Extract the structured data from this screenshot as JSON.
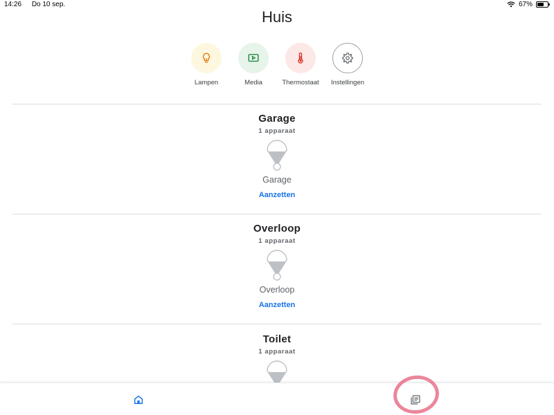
{
  "status": {
    "time": "14:26",
    "date": "Do 10 sep.",
    "battery": "67%",
    "battery_level": 0.67
  },
  "title": "Huis",
  "shortcuts": [
    {
      "label": "Lampen",
      "icon": "lightbulb-icon",
      "color": "#e37400",
      "bg": "#fef7e0"
    },
    {
      "label": "Media",
      "icon": "media-play-icon",
      "color": "#188038",
      "bg": "#e6f4ea"
    },
    {
      "label": "Thermostaat",
      "icon": "thermometer-icon",
      "color": "#d93025",
      "bg": "#fce8e6"
    },
    {
      "label": "Instellingen",
      "icon": "gear-icon",
      "color": "#5f6368",
      "bg": "#ffffff"
    }
  ],
  "rooms": [
    {
      "name": "Garage",
      "count": "1 apparaat",
      "device": "Garage",
      "action": "Aanzetten"
    },
    {
      "name": "Overloop",
      "count": "1 apparaat",
      "device": "Overloop",
      "action": "Aanzetten"
    },
    {
      "name": "Toilet",
      "count": "1 apparaat",
      "device": "",
      "action": ""
    }
  ],
  "nav": [
    {
      "icon": "home-icon",
      "color": "#1a73e8"
    },
    {
      "icon": "feed-icon",
      "color": "#5f6368"
    }
  ],
  "colors": {
    "accent": "#1a73e8",
    "annotation": "#e8718a"
  }
}
